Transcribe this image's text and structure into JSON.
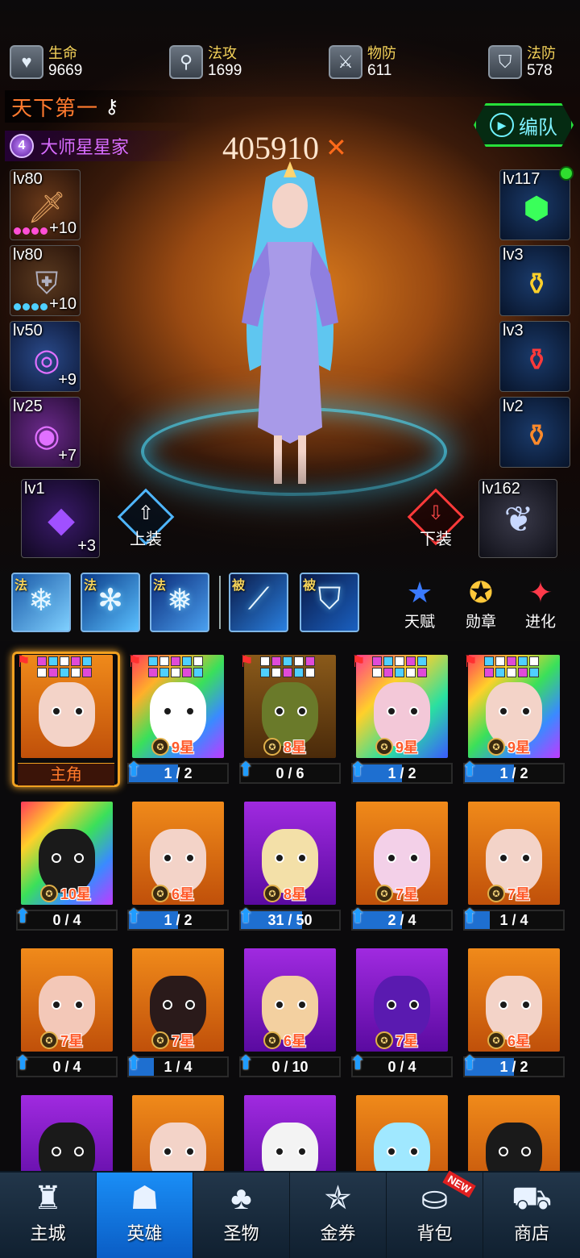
{
  "stats": [
    {
      "label": "生命",
      "value": "9669",
      "icon": "heart-shield-icon"
    },
    {
      "label": "法攻",
      "value": "1699",
      "icon": "wand-icon"
    },
    {
      "label": "物防",
      "value": "611",
      "icon": "sword-shield-icon"
    },
    {
      "label": "法防",
      "value": "578",
      "icon": "lock-shield-icon"
    }
  ],
  "title": "天下第一",
  "rank": {
    "badge": "4",
    "label": "大师星星家"
  },
  "power": "405910",
  "team_button": "编队",
  "left_equipment": [
    {
      "level": "lv80",
      "plus": "+10"
    },
    {
      "level": "lv80",
      "plus": "+10"
    },
    {
      "level": "lv50",
      "plus": "+9"
    },
    {
      "level": "lv25",
      "plus": "+7"
    }
  ],
  "right_equipment": [
    {
      "level": "lv117"
    },
    {
      "level": "lv3"
    },
    {
      "level": "lv3"
    },
    {
      "level": "lv2"
    }
  ],
  "crystal": {
    "level": "lv1",
    "plus": "+3"
  },
  "wings": {
    "level": "lv162"
  },
  "equip_on": "上装",
  "equip_off": "下装",
  "skills": [
    {
      "tag": "法"
    },
    {
      "tag": "法"
    },
    {
      "tag": "法"
    },
    {
      "tag": "被"
    },
    {
      "tag": "被"
    }
  ],
  "side_buttons": [
    {
      "label": "天赋",
      "icon": "star-icon"
    },
    {
      "label": "勋章",
      "icon": "medal-icon"
    },
    {
      "label": "进化",
      "icon": "evolve-icon"
    }
  ],
  "main_label": "主角",
  "heroes": [
    {
      "stars": "9星",
      "frac": "1 / 2",
      "progress": 0.5
    },
    {
      "stars": "8星",
      "frac": "0 / 6",
      "progress": 0
    },
    {
      "stars": "9星",
      "frac": "1 / 2",
      "progress": 0.5
    },
    {
      "stars": "9星",
      "frac": "1 / 2",
      "progress": 0.5
    },
    {
      "stars": "10星",
      "frac": "0 / 4",
      "progress": 0
    },
    {
      "stars": "6星",
      "frac": "1 / 2",
      "progress": 0.5
    },
    {
      "stars": "8星",
      "frac": "31 / 50",
      "progress": 0.62
    },
    {
      "stars": "7星",
      "frac": "2 / 4",
      "progress": 0.5
    },
    {
      "stars": "7星",
      "frac": "1 / 4",
      "progress": 0.25
    },
    {
      "stars": "7星",
      "frac": "0 / 4",
      "progress": 0
    },
    {
      "stars": "7星",
      "frac": "1 / 4",
      "progress": 0.25
    },
    {
      "stars": "6星",
      "frac": "0 / 10",
      "progress": 0
    },
    {
      "stars": "7星",
      "frac": "0 / 4",
      "progress": 0
    },
    {
      "stars": "6星",
      "frac": "1 / 2",
      "progress": 0.5
    }
  ],
  "nav": [
    {
      "label": "主城",
      "icon": "castle-icon"
    },
    {
      "label": "英雄",
      "icon": "helmet-icon"
    },
    {
      "label": "圣物",
      "icon": "clover-icon"
    },
    {
      "label": "金券",
      "icon": "ticket-icon"
    },
    {
      "label": "背包",
      "icon": "backpack-icon"
    },
    {
      "label": "商店",
      "icon": "cart-icon"
    }
  ],
  "new_badge": "NEW",
  "colors": {
    "accent": "#1a8ef6",
    "power": "#ffe6cf",
    "title": "#ff7a2f",
    "team": "#27e03a"
  }
}
